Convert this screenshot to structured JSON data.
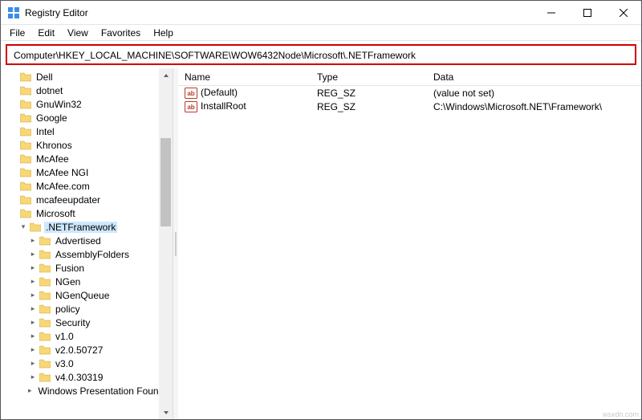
{
  "window": {
    "title": "Registry Editor"
  },
  "menus": [
    "File",
    "Edit",
    "View",
    "Favorites",
    "Help"
  ],
  "address": "Computer\\HKEY_LOCAL_MACHINE\\SOFTWARE\\WOW6432Node\\Microsoft\\.NETFramework",
  "tree": [
    {
      "label": "Dell",
      "depth": 1,
      "expander": "",
      "selected": false
    },
    {
      "label": "dotnet",
      "depth": 1,
      "expander": "",
      "selected": false
    },
    {
      "label": "GnuWin32",
      "depth": 1,
      "expander": "",
      "selected": false
    },
    {
      "label": "Google",
      "depth": 1,
      "expander": "",
      "selected": false
    },
    {
      "label": "Intel",
      "depth": 1,
      "expander": "",
      "selected": false
    },
    {
      "label": "Khronos",
      "depth": 1,
      "expander": "",
      "selected": false
    },
    {
      "label": "McAfee",
      "depth": 1,
      "expander": "",
      "selected": false
    },
    {
      "label": "McAfee NGI",
      "depth": 1,
      "expander": "",
      "selected": false
    },
    {
      "label": "McAfee.com",
      "depth": 1,
      "expander": "",
      "selected": false
    },
    {
      "label": "mcafeeupdater",
      "depth": 1,
      "expander": "",
      "selected": false
    },
    {
      "label": "Microsoft",
      "depth": 1,
      "expander": "",
      "selected": false
    },
    {
      "label": ".NETFramework",
      "depth": 2,
      "expander": "▾",
      "selected": true
    },
    {
      "label": "Advertised",
      "depth": 3,
      "expander": "▸",
      "selected": false
    },
    {
      "label": "AssemblyFolders",
      "depth": 3,
      "expander": "▸",
      "selected": false
    },
    {
      "label": "Fusion",
      "depth": 3,
      "expander": "▸",
      "selected": false
    },
    {
      "label": "NGen",
      "depth": 3,
      "expander": "▸",
      "selected": false
    },
    {
      "label": "NGenQueue",
      "depth": 3,
      "expander": "▸",
      "selected": false
    },
    {
      "label": "policy",
      "depth": 3,
      "expander": "▸",
      "selected": false
    },
    {
      "label": "Security",
      "depth": 3,
      "expander": "▸",
      "selected": false
    },
    {
      "label": "v1.0",
      "depth": 3,
      "expander": "▸",
      "selected": false
    },
    {
      "label": "v2.0.50727",
      "depth": 3,
      "expander": "▸",
      "selected": false
    },
    {
      "label": "v3.0",
      "depth": 3,
      "expander": "▸",
      "selected": false
    },
    {
      "label": "v4.0.30319",
      "depth": 3,
      "expander": "▸",
      "selected": false
    },
    {
      "label": "Windows Presentation Foundat",
      "depth": 3,
      "expander": "▸",
      "selected": false
    }
  ],
  "columns": {
    "name": "Name",
    "type": "Type",
    "data": "Data"
  },
  "values": [
    {
      "name": "(Default)",
      "type": "REG_SZ",
      "data": "(value not set)"
    },
    {
      "name": "InstallRoot",
      "type": "REG_SZ",
      "data": "C:\\Windows\\Microsoft.NET\\Framework\\"
    }
  ],
  "watermark": "wsxdn.com",
  "icons": {
    "folder_fill": "#f8d777",
    "folder_stroke": "#caa43a",
    "value_border": "#b53a2b",
    "value_fill": "#fff",
    "value_text": "ab"
  }
}
